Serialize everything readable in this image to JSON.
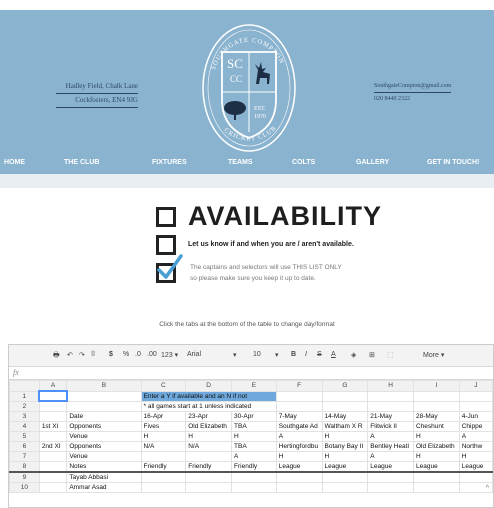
{
  "address_left": {
    "line1": "Hadley Field, Chalk Lane",
    "line2": "Cockfosters, EN4 9JG"
  },
  "address_right": {
    "email": "SouthgateCompton@gmail.com",
    "phone": "020 8440 2322"
  },
  "logo": {
    "top_text": "SOUTHGATE COMPTON",
    "monogram_sc": "SC",
    "monogram_cc": "CC",
    "est": "EST.",
    "year": "1970",
    "bottom_text": "CRICKET CLUB"
  },
  "nav": {
    "home": "HOME",
    "club": "THE CLUB",
    "fixtures": "FIXTURES",
    "teams": "TEAMS",
    "colts": "COLTS",
    "gallery": "GALLERY",
    "contact": "GET IN TOUCH!"
  },
  "availability": {
    "title": "AVAILABILITY",
    "subtitle": "Let us know if and when you are / aren't available.",
    "note1": "The captains and selectors will use THIS LIST ONLY",
    "note2": "so please make sure you keep it up to date."
  },
  "hint": "Click the tabs at the bottom of the table to change day/format",
  "toolbar": {
    "print": "🖶",
    "undo": "↶",
    "redo": "↷",
    "paint": "⌷",
    "currency": "$",
    "percent": "%",
    "dec_less": ".0",
    "dec_more": ".00",
    "numfmt": "123 ▾",
    "font": "Arial",
    "font_caret": "▾",
    "size": "10",
    "size_caret": "▾",
    "bold": "B",
    "italic": "I",
    "strike": "S",
    "textcolor": "A",
    "fill": "◈",
    "borders": "⊞",
    "merge": "⬚",
    "more": "More ▾"
  },
  "fx": "fx",
  "columns": [
    "",
    "A",
    "B",
    "C",
    "D",
    "E",
    "F",
    "G",
    "H",
    "I",
    "J"
  ],
  "rows": [
    [
      "1",
      "",
      "",
      "Enter a Y if available and an N if not",
      "",
      "",
      "",
      "",
      "",
      "",
      ""
    ],
    [
      "2",
      "",
      "",
      "* all games start at 1 unless indicated",
      "",
      "",
      "",
      "",
      "",
      "",
      ""
    ],
    [
      "3",
      "",
      "Date",
      "16-Apr",
      "23-Apr",
      "30-Apr",
      "7-May",
      "14-May",
      "21-May",
      "28-May",
      "4-Jun"
    ],
    [
      "4",
      "1st XI",
      "Opponents",
      "Fives",
      "Old Elizabeth",
      "TBA",
      "Southgate Ad",
      "Waltham X R",
      "Flitwick II",
      "Cheshunt",
      "Chippe"
    ],
    [
      "5",
      "",
      "Venue",
      "H",
      "H",
      "H",
      "A",
      "H",
      "A",
      "H",
      "A"
    ],
    [
      "6",
      "2nd XI",
      "Opponents",
      "N/A",
      "N/A",
      "TBA",
      "Hertingfordbu",
      "Botany Bay II",
      "Bentley Heatl",
      "Old Elizabeth",
      "Northw"
    ],
    [
      "7",
      "",
      "Venue",
      "",
      "",
      "A",
      "H",
      "H",
      "A",
      "H",
      "H"
    ],
    [
      "8",
      "",
      "Notes",
      "Friendly",
      "Friendly",
      "Friendly",
      "League",
      "League",
      "League",
      "League",
      "League"
    ],
    [
      "9",
      "",
      "Tayab Abbasi",
      "",
      "",
      "",
      "",
      "",
      "",
      "",
      ""
    ],
    [
      "10",
      "",
      "Ammar Asad",
      "",
      "",
      "",
      "",
      "",
      "",
      "",
      ""
    ]
  ],
  "scroll_up": "^"
}
